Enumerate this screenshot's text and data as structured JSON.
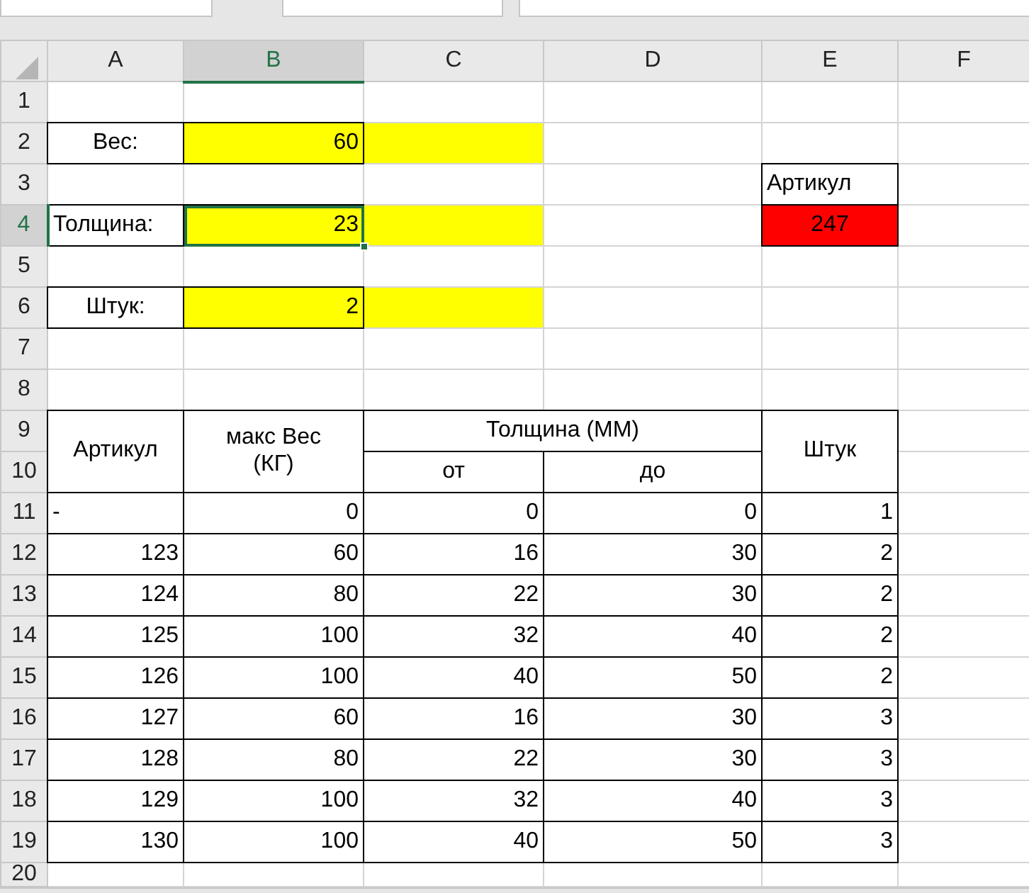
{
  "columns": [
    {
      "label": "A",
      "selected": false
    },
    {
      "label": "B",
      "selected": true
    },
    {
      "label": "C",
      "selected": false
    },
    {
      "label": "D",
      "selected": false
    },
    {
      "label": "E",
      "selected": false
    },
    {
      "label": "F",
      "selected": false
    }
  ],
  "rows": [
    {
      "label": "1",
      "selected": false,
      "cells": [
        {
          "kind": "empty"
        },
        {
          "kind": "empty"
        },
        {
          "kind": "empty"
        },
        {
          "kind": "empty"
        },
        {
          "kind": "empty"
        },
        {
          "kind": "empty"
        }
      ]
    },
    {
      "label": "2",
      "selected": false,
      "cells": [
        {
          "kind": "caption",
          "text": "Вес:",
          "selected": false
        },
        {
          "kind": "input",
          "text": "60",
          "color": "#ffff00",
          "selected": false
        },
        {
          "kind": "fill",
          "color": "#ffff00",
          "selected": false
        },
        {
          "kind": "empty"
        },
        {
          "kind": "empty"
        },
        {
          "kind": "empty"
        }
      ]
    },
    {
      "label": "3",
      "selected": false,
      "cells": [
        {
          "kind": "empty"
        },
        {
          "kind": "empty"
        },
        {
          "kind": "empty"
        },
        {
          "kind": "empty"
        },
        {
          "kind": "text",
          "text": "Артикул",
          "selected": false
        },
        {
          "kind": "empty"
        }
      ]
    },
    {
      "label": "4",
      "selected": true,
      "cells": [
        {
          "kind": "text",
          "text": "Толщина:",
          "selected": false
        },
        {
          "kind": "input",
          "text": "23",
          "color": "#ffff00",
          "selected": true
        },
        {
          "kind": "fill",
          "color": "#ffff00",
          "selected": false
        },
        {
          "kind": "empty"
        },
        {
          "kind": "caption",
          "text": "247",
          "color": "#ff0000",
          "selected": false
        },
        {
          "kind": "empty"
        }
      ]
    },
    {
      "label": "5",
      "selected": false,
      "cells": [
        {
          "kind": "empty"
        },
        {
          "kind": "empty"
        },
        {
          "kind": "empty"
        },
        {
          "kind": "empty"
        },
        {
          "kind": "empty"
        },
        {
          "kind": "empty"
        }
      ]
    },
    {
      "label": "6",
      "selected": false,
      "cells": [
        {
          "kind": "caption",
          "text": "Штук:",
          "selected": false
        },
        {
          "kind": "input",
          "text": "2",
          "color": "#ffff00",
          "selected": false
        },
        {
          "kind": "fill",
          "color": "#ffff00",
          "selected": false
        },
        {
          "kind": "empty"
        },
        {
          "kind": "empty"
        },
        {
          "kind": "empty"
        }
      ]
    },
    {
      "label": "7",
      "selected": false,
      "cells": [
        {
          "kind": "empty"
        },
        {
          "kind": "empty"
        },
        {
          "kind": "empty"
        },
        {
          "kind": "empty"
        },
        {
          "kind": "empty"
        },
        {
          "kind": "empty"
        }
      ]
    },
    {
      "label": "8",
      "selected": false,
      "cells": [
        {
          "kind": "empty"
        },
        {
          "kind": "empty"
        },
        {
          "kind": "empty"
        },
        {
          "kind": "empty"
        },
        {
          "kind": "empty"
        },
        {
          "kind": "empty"
        }
      ]
    },
    {
      "label": "9",
      "selected": false,
      "cells": [
        {
          "kind": "tall",
          "text": "Артикул",
          "selected": false
        },
        {
          "kind": "tall",
          "text": "макс Вес\n(КГ)",
          "selected": false
        },
        {
          "kind": "wide",
          "text": "Толщина (ММ)",
          "selected": false
        },
        {
          "kind": "tall",
          "text": "Штук",
          "selected": false
        },
        {
          "kind": "empty"
        }
      ]
    },
    {
      "label": "10",
      "selected": false,
      "cells": [
        {
          "kind": "caption",
          "text": "от",
          "selected": false
        },
        {
          "kind": "caption",
          "text": "до",
          "selected": false
        },
        {
          "kind": "empty"
        }
      ]
    },
    {
      "label": "11",
      "selected": false,
      "cells": [
        {
          "kind": "text",
          "text": "-",
          "selected": false
        },
        {
          "kind": "number",
          "text": "0",
          "selected": false
        },
        {
          "kind": "number",
          "text": "0",
          "selected": false
        },
        {
          "kind": "number",
          "text": "0",
          "selected": false
        },
        {
          "kind": "number",
          "text": "1",
          "selected": false
        },
        {
          "kind": "empty"
        }
      ]
    },
    {
      "label": "12",
      "selected": false,
      "cells": [
        {
          "kind": "number",
          "text": "123",
          "selected": false
        },
        {
          "kind": "number",
          "text": "60",
          "selected": false
        },
        {
          "kind": "number",
          "text": "16",
          "selected": false
        },
        {
          "kind": "number",
          "text": "30",
          "selected": false
        },
        {
          "kind": "number",
          "text": "2",
          "selected": false
        },
        {
          "kind": "empty"
        }
      ]
    },
    {
      "label": "13",
      "selected": false,
      "cells": [
        {
          "kind": "number",
          "text": "124",
          "selected": false
        },
        {
          "kind": "number",
          "text": "80",
          "selected": false
        },
        {
          "kind": "number",
          "text": "22",
          "selected": false
        },
        {
          "kind": "number",
          "text": "30",
          "selected": false
        },
        {
          "kind": "number",
          "text": "2",
          "selected": false
        },
        {
          "kind": "empty"
        }
      ]
    },
    {
      "label": "14",
      "selected": false,
      "cells": [
        {
          "kind": "number",
          "text": "125",
          "selected": false
        },
        {
          "kind": "number",
          "text": "100",
          "selected": false
        },
        {
          "kind": "number",
          "text": "32",
          "selected": false
        },
        {
          "kind": "number",
          "text": "40",
          "selected": false
        },
        {
          "kind": "number",
          "text": "2",
          "selected": false
        },
        {
          "kind": "empty"
        }
      ]
    },
    {
      "label": "15",
      "selected": false,
      "cells": [
        {
          "kind": "number",
          "text": "126",
          "selected": false
        },
        {
          "kind": "number",
          "text": "100",
          "selected": false
        },
        {
          "kind": "number",
          "text": "40",
          "selected": false
        },
        {
          "kind": "number",
          "text": "50",
          "selected": false
        },
        {
          "kind": "number",
          "text": "2",
          "selected": false
        },
        {
          "kind": "empty"
        }
      ]
    },
    {
      "label": "16",
      "selected": false,
      "cells": [
        {
          "kind": "number",
          "text": "127",
          "selected": false
        },
        {
          "kind": "number",
          "text": "60",
          "selected": false
        },
        {
          "kind": "number",
          "text": "16",
          "selected": false
        },
        {
          "kind": "number",
          "text": "30",
          "selected": false
        },
        {
          "kind": "number",
          "text": "3",
          "selected": false
        },
        {
          "kind": "empty"
        }
      ]
    },
    {
      "label": "17",
      "selected": false,
      "cells": [
        {
          "kind": "number",
          "text": "128",
          "selected": false
        },
        {
          "kind": "number",
          "text": "80",
          "selected": false
        },
        {
          "kind": "number",
          "text": "22",
          "selected": false
        },
        {
          "kind": "number",
          "text": "30",
          "selected": false
        },
        {
          "kind": "number",
          "text": "3",
          "selected": false
        },
        {
          "kind": "empty"
        }
      ]
    },
    {
      "label": "18",
      "selected": false,
      "cells": [
        {
          "kind": "number",
          "text": "129",
          "selected": false
        },
        {
          "kind": "number",
          "text": "100",
          "selected": false
        },
        {
          "kind": "number",
          "text": "32",
          "selected": false
        },
        {
          "kind": "number",
          "text": "40",
          "selected": false
        },
        {
          "kind": "number",
          "text": "3",
          "selected": false
        },
        {
          "kind": "empty"
        }
      ]
    },
    {
      "label": "19",
      "selected": false,
      "cells": [
        {
          "kind": "number",
          "text": "130",
          "selected": false
        },
        {
          "kind": "number",
          "text": "100",
          "selected": false
        },
        {
          "kind": "number",
          "text": "40",
          "selected": false
        },
        {
          "kind": "number",
          "text": "50",
          "selected": false
        },
        {
          "kind": "number",
          "text": "3",
          "selected": false
        },
        {
          "kind": "empty"
        }
      ]
    },
    {
      "label": "20",
      "selected": false,
      "cells": [
        {
          "kind": "empty"
        },
        {
          "kind": "empty"
        },
        {
          "kind": "empty"
        },
        {
          "kind": "empty"
        },
        {
          "kind": "empty"
        },
        {
          "kind": "empty"
        }
      ]
    }
  ]
}
